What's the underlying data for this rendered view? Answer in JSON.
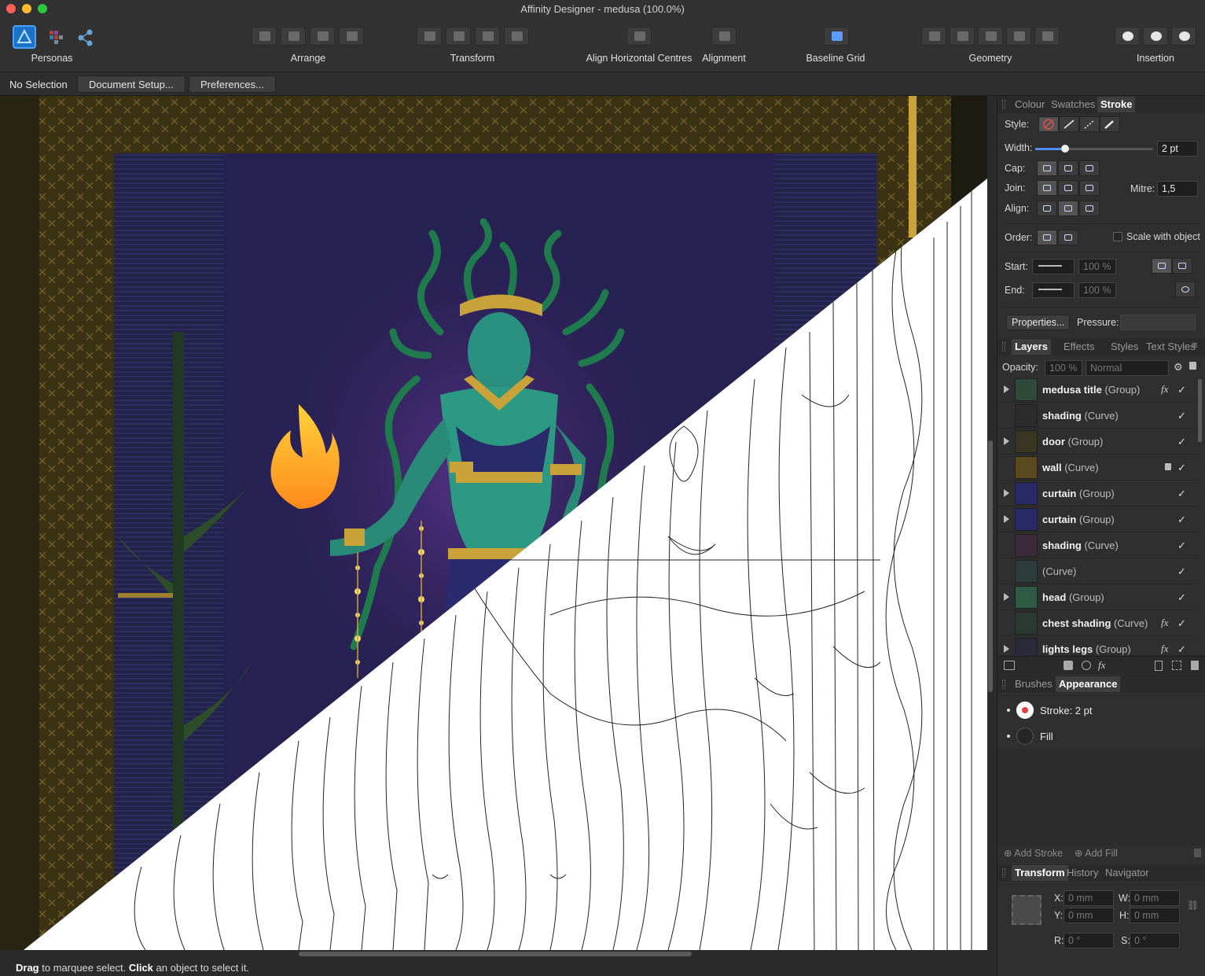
{
  "window": {
    "title": "Affinity Designer - medusa (100.0%)"
  },
  "toolbar": {
    "personas_label": "Personas",
    "groups": [
      {
        "label": "Arrange"
      },
      {
        "label": "Transform"
      },
      {
        "label": "Align Horizontal Centres"
      },
      {
        "label": "Alignment"
      },
      {
        "label": "Baseline Grid"
      },
      {
        "label": "Geometry"
      },
      {
        "label": "Insertion"
      }
    ]
  },
  "context": {
    "selection": "No Selection",
    "document_setup": "Document Setup...",
    "preferences": "Preferences..."
  },
  "stroke_panel": {
    "tabs": [
      "Colour",
      "Swatches",
      "Stroke"
    ],
    "active_tab": "Stroke",
    "style_label": "Style:",
    "width_label": "Width:",
    "width_value": "2 pt",
    "width_fraction": 0.25,
    "cap_label": "Cap:",
    "join_label": "Join:",
    "mitre_label": "Mitre:",
    "mitre_value": "1,5",
    "align_label": "Align:",
    "order_label": "Order:",
    "scale_with_object": "Scale with object",
    "start_label": "Start:",
    "end_label": "End:",
    "start_pct": "100 %",
    "end_pct": "100 %",
    "properties_button": "Properties...",
    "pressure_label": "Pressure:"
  },
  "layers_panel": {
    "tabs": [
      "Layers",
      "Effects",
      "Styles",
      "Text Styles"
    ],
    "active_tab": "Layers",
    "opacity_label": "Opacity:",
    "opacity_value": "100 %",
    "blend_mode": "Normal",
    "layers": [
      {
        "name": "medusa title",
        "type": "(Group)",
        "expandable": true,
        "fx": true,
        "locked": false,
        "thumb": "#2f4a3a"
      },
      {
        "name": "shading",
        "type": "(Curve)",
        "expandable": false,
        "fx": false,
        "locked": false,
        "thumb": "#2c2c2c"
      },
      {
        "name": "door",
        "type": "(Group)",
        "expandable": true,
        "fx": false,
        "locked": false,
        "thumb": "#3a3422"
      },
      {
        "name": "wall",
        "type": "(Curve)",
        "expandable": false,
        "fx": false,
        "locked": true,
        "thumb": "#5a4a1e"
      },
      {
        "name": "curtain",
        "type": "(Group)",
        "expandable": true,
        "fx": false,
        "locked": false,
        "thumb": "#2a2a66"
      },
      {
        "name": "curtain",
        "type": "(Group)",
        "expandable": true,
        "fx": false,
        "locked": false,
        "thumb": "#2a2a66"
      },
      {
        "name": "shading",
        "type": "(Curve)",
        "expandable": false,
        "fx": false,
        "locked": false,
        "thumb": "#3a2a3a"
      },
      {
        "name": "",
        "type": "(Curve)",
        "expandable": false,
        "fx": false,
        "locked": false,
        "thumb": "#2f3d3a"
      },
      {
        "name": "head",
        "type": "(Group)",
        "expandable": true,
        "fx": false,
        "locked": false,
        "thumb": "#2f5a44"
      },
      {
        "name": "chest shading",
        "type": "(Curve)",
        "expandable": false,
        "fx": true,
        "locked": false,
        "thumb": "#2a3a33"
      },
      {
        "name": "lights legs",
        "type": "(Group)",
        "expandable": true,
        "fx": true,
        "locked": false,
        "thumb": "#2a2a3a"
      }
    ]
  },
  "appearance_panel": {
    "tabs": [
      "Brushes",
      "Appearance"
    ],
    "active_tab": "Appearance",
    "items": [
      {
        "label": "Stroke: 2 pt",
        "kind": "stroke"
      },
      {
        "label": "Fill",
        "kind": "fill"
      }
    ],
    "add_stroke": "Add Stroke",
    "add_fill": "Add Fill"
  },
  "transform_panel": {
    "tabs": [
      "Transform",
      "History",
      "Navigator"
    ],
    "active_tab": "Transform",
    "x_label": "X:",
    "x_value": "0 mm",
    "y_label": "Y:",
    "y_value": "0 mm",
    "w_label": "W:",
    "w_value": "0 mm",
    "h_label": "H:",
    "h_value": "0 mm",
    "r_label": "R:",
    "r_value": "0 °",
    "s_label": "S:",
    "s_value": "0 °"
  },
  "status": {
    "drag": "Drag",
    "drag_text": "to marquee select.",
    "click": "Click",
    "click_text": "an object to select it."
  }
}
